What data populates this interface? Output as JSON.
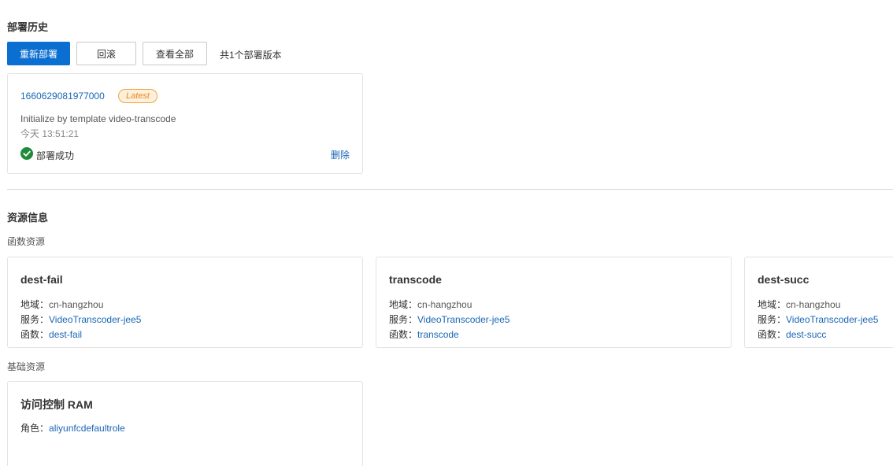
{
  "deploy_history": {
    "title": "部署历史",
    "redeploy_label": "重新部署",
    "rollback_label": "回滚",
    "view_all_label": "查看全部",
    "version_count_text": "共1个部署版本",
    "version": {
      "id": "1660629081977000",
      "badge": "Latest",
      "description": "Initialize by template video-transcode",
      "time": "今天 13:51:21",
      "status": "部署成功",
      "delete_label": "删除"
    }
  },
  "resource_info": {
    "title": "资源信息",
    "function_resources_label": "函数资源",
    "base_resources_label": "基础资源",
    "labels": {
      "region": "地域：",
      "service": "服务：",
      "function": "函数：",
      "role": "角色："
    },
    "functions": [
      {
        "name": "dest-fail",
        "region": "cn-hangzhou",
        "service": "VideoTranscoder-jee5",
        "function": "dest-fail"
      },
      {
        "name": "transcode",
        "region": "cn-hangzhou",
        "service": "VideoTranscoder-jee5",
        "function": "transcode"
      },
      {
        "name": "dest-succ",
        "region": "cn-hangzhou",
        "service": "VideoTranscoder-jee5",
        "function": "dest-succ"
      }
    ],
    "base": [
      {
        "name": "访问控制 RAM",
        "role": "aliyunfcdefaultrole"
      }
    ]
  },
  "colors": {
    "primary": "#0b6fd1",
    "link": "#1a66b5",
    "success": "#1f8a3a",
    "badge_border": "#f3a43a"
  }
}
